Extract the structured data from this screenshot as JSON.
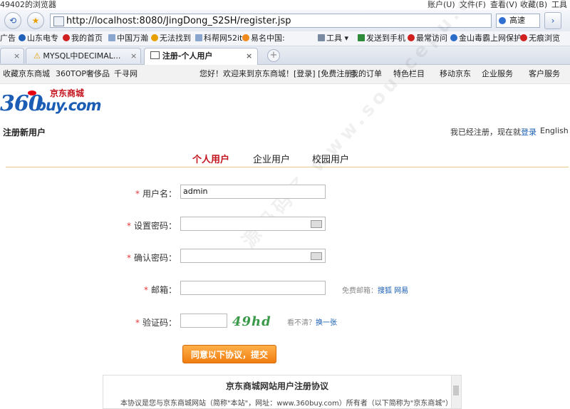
{
  "window": {
    "title": "49402的浏览器",
    "menu": [
      "账户(U)",
      "文件(F)",
      "查看(V)",
      "收藏(B)",
      "工具"
    ]
  },
  "address": {
    "url": "http://localhost:8080/JingDong_S2SH/register.jsp",
    "engine": "高速"
  },
  "favorites": [
    "广告",
    "山东电专",
    "我的首页",
    "中国万瀚",
    "无法找到",
    "科帮网52it",
    "易名中国:",
    "工具",
    "发送到手机",
    "最常访问",
    "金山毒霸上网保护",
    "无痕浏览"
  ],
  "tabs": [
    {
      "label": ""
    },
    {
      "label": "MYSQL中DECIMAL..."
    },
    {
      "label": "注册-个人用户"
    }
  ],
  "topnav": {
    "left": [
      "收藏京东商城",
      "360TOP奢侈品",
      "千寻网"
    ],
    "welcome": "您好！欢迎来到京东商城！[登录] [免费注册]",
    "right": [
      "我的订单",
      "特色栏目",
      "移动京东",
      "企业服务",
      "客户服务"
    ]
  },
  "logo": {
    "brand": "京东商城",
    "text360": "360",
    "textbuy": "buy.com"
  },
  "page": {
    "title": "注册新用户",
    "already": "我已经注册，现在就",
    "login": "登录",
    "english": "English",
    "tabs": [
      "个人用户",
      "企业用户",
      "校园用户"
    ]
  },
  "form": {
    "required": "*",
    "username_label": "用户名：",
    "username_value": "admin",
    "password_label": "设置密码：",
    "confirm_label": "确认密码：",
    "email_label": "邮箱：",
    "email_hint": "免费邮箱：",
    "email_links": [
      "搜狐",
      "网易"
    ],
    "captcha_label": "验证码：",
    "captcha_image_text": "49hd",
    "captcha_hint": "看不清？",
    "captcha_refresh": "换一张",
    "submit": "同意以下协议，提交"
  },
  "agreement": {
    "title": "京东商城网站用户注册协议",
    "body": "本协议是您与京东商城网站（简称\"本站\"，网址：www.360buy.com）所有者（以下简称为\"京东商城\"）之"
  },
  "watermark": "源码码了 www.sourcepu.com",
  "colors": {
    "accent": "#c4121c",
    "link": "#1a5fb4",
    "button": "#f08a1c"
  }
}
